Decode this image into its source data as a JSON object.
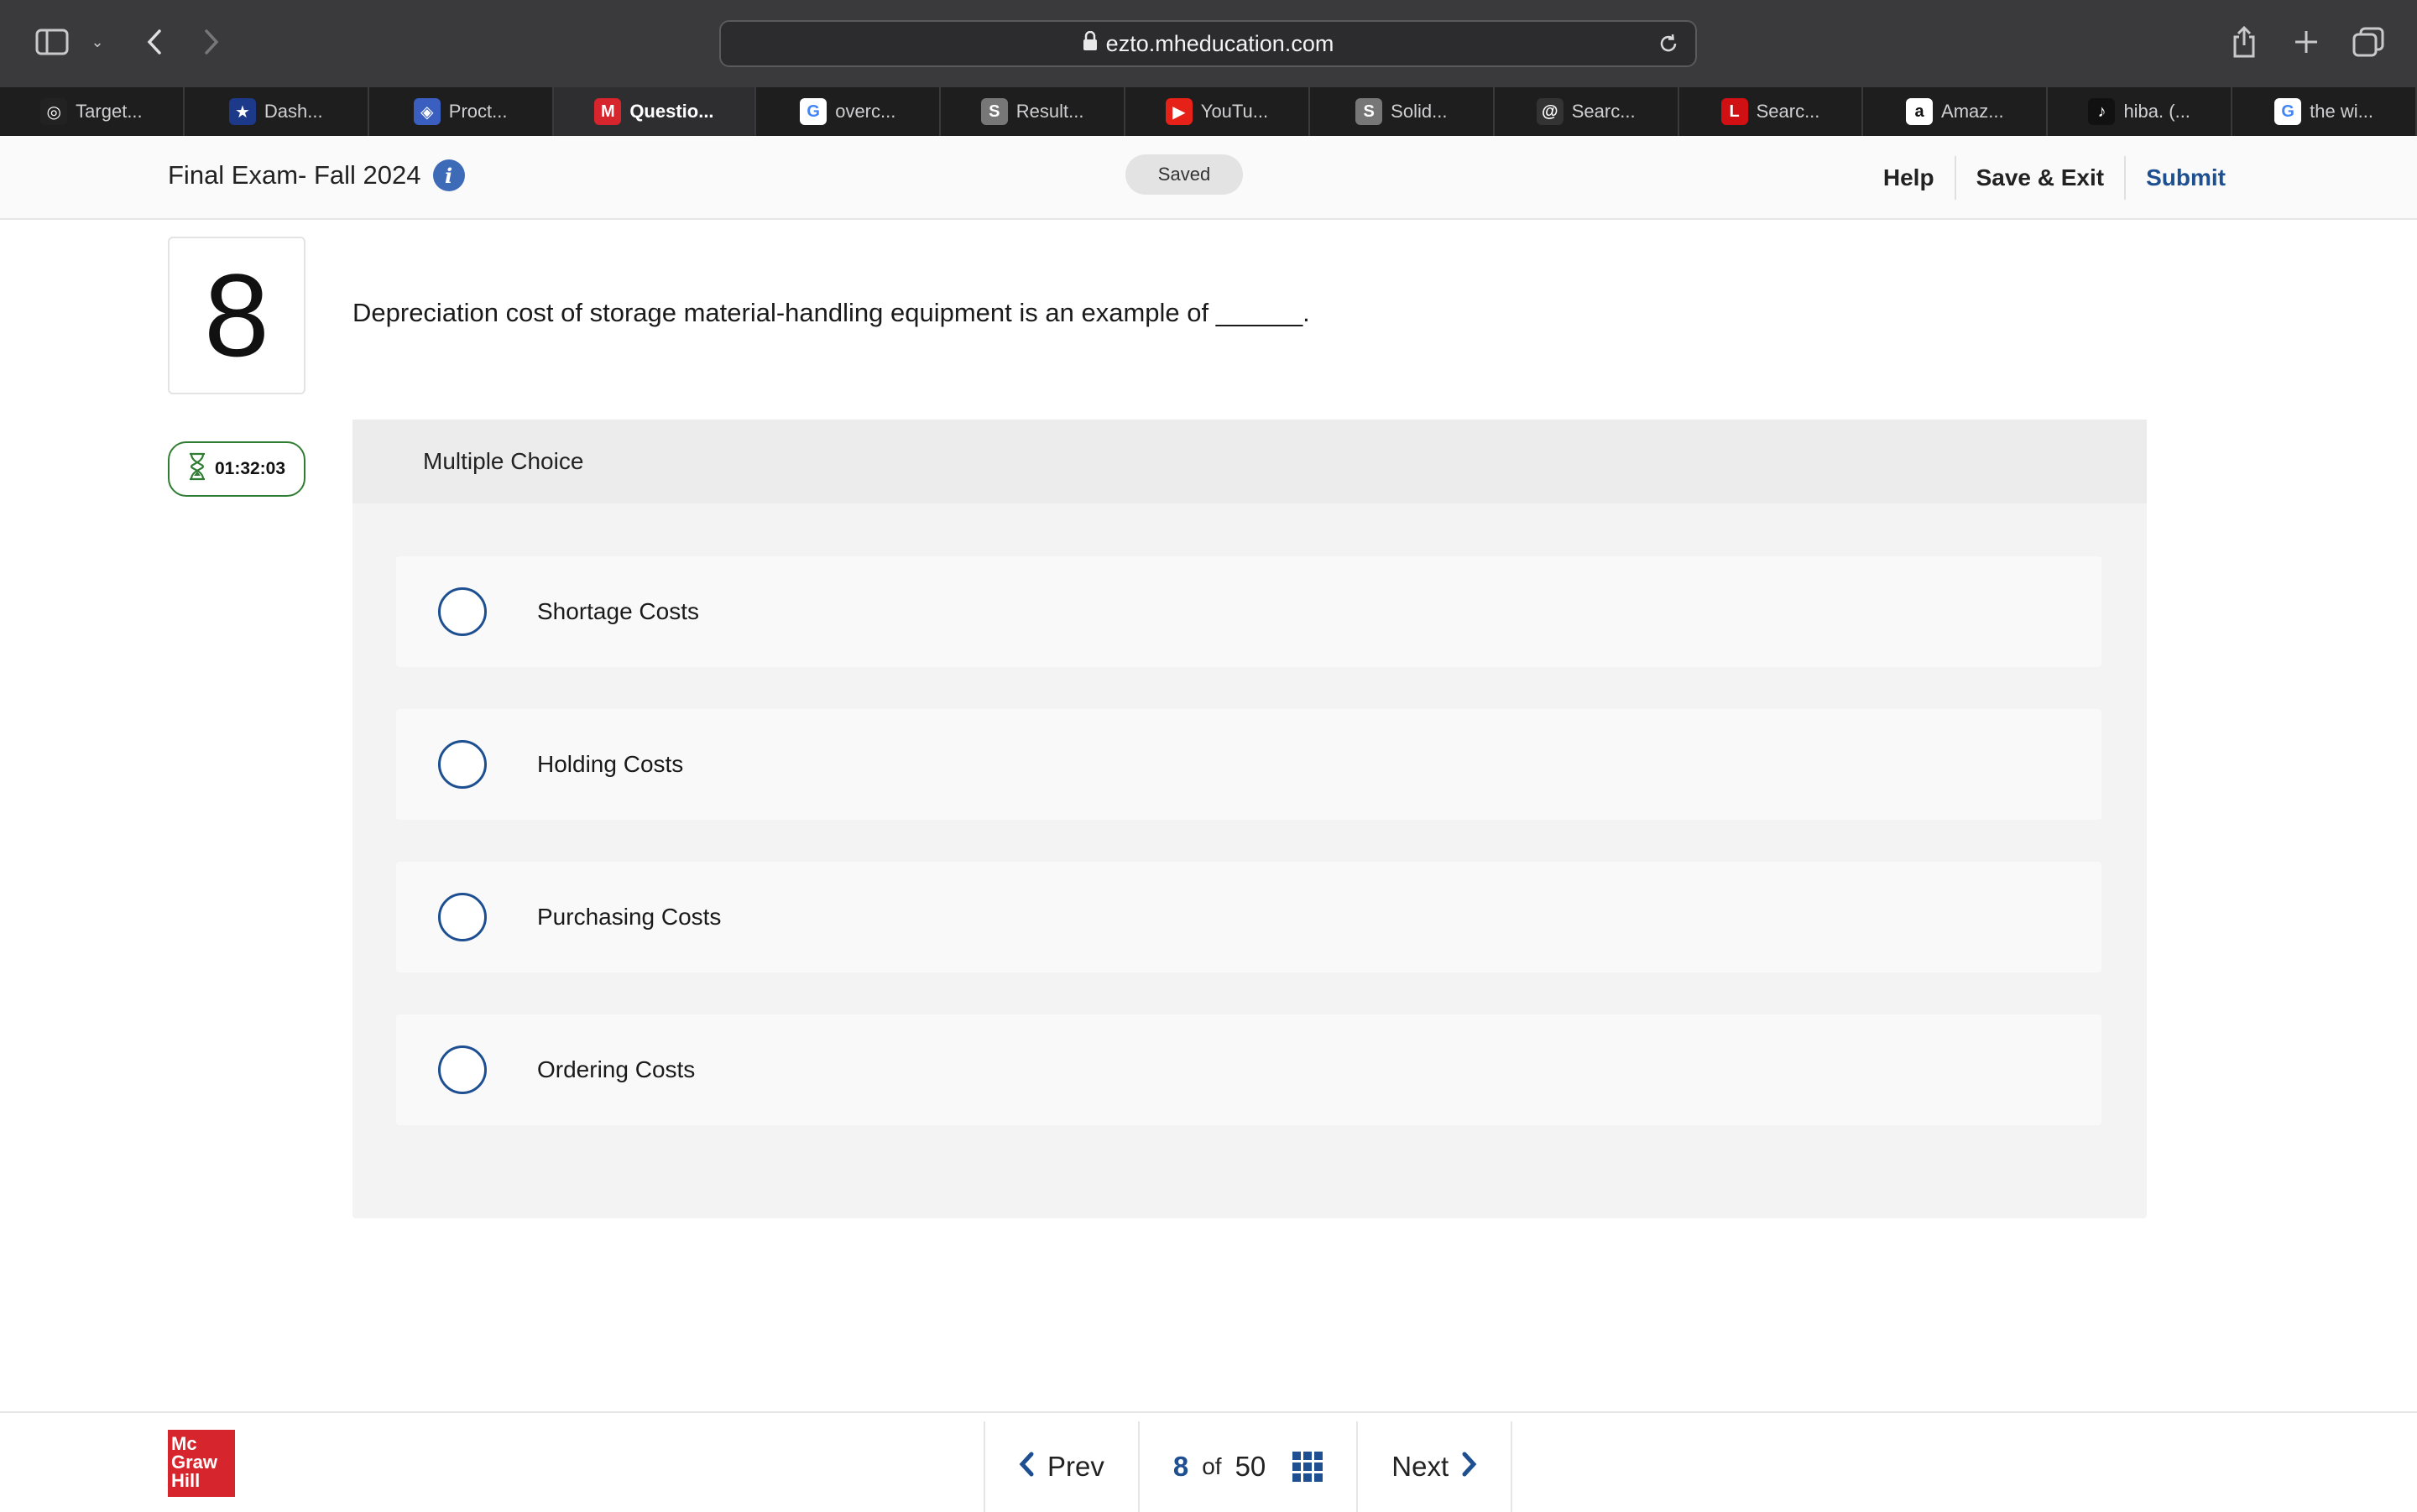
{
  "browser": {
    "url": "ezto.mheducation.com",
    "tabs": [
      {
        "label": "Target...",
        "icon": "openai-icon",
        "color": "#222222"
      },
      {
        "label": "Dash...",
        "icon": "star-badge-icon",
        "color": "#1d3a8a"
      },
      {
        "label": "Proct...",
        "icon": "shield-icon",
        "color": "#3b5fc0"
      },
      {
        "label": "Questio...",
        "icon": "mcgraw-m-icon",
        "color": "#d6252c",
        "active": true
      },
      {
        "label": "overc...",
        "icon": "google-icon",
        "color": "#ffffff"
      },
      {
        "label": "Result...",
        "icon": "s-icon",
        "color": "#777777"
      },
      {
        "label": "YouTu...",
        "icon": "youtube-icon",
        "color": "#e62117"
      },
      {
        "label": "Solid...",
        "icon": "s-icon",
        "color": "#777777"
      },
      {
        "label": "Searc...",
        "icon": "at-icon",
        "color": "#333333"
      },
      {
        "label": "Searc...",
        "icon": "lego-icon",
        "color": "#d01012"
      },
      {
        "label": "Amaz...",
        "icon": "amazon-icon",
        "color": "#ffffff"
      },
      {
        "label": "hiba. (...",
        "icon": "tiktok-icon",
        "color": "#111111"
      },
      {
        "label": "the wi...",
        "icon": "google-icon",
        "color": "#ffffff"
      }
    ]
  },
  "header": {
    "exam_title": "Final Exam- Fall 2024",
    "status": "Saved",
    "help": "Help",
    "save_exit": "Save & Exit",
    "submit": "Submit"
  },
  "question": {
    "number": "8",
    "text": "Depreciation cost of storage material-handling equipment is an example of ______.",
    "timer": "01:32:03",
    "type_label": "Multiple Choice",
    "options": [
      "Shortage Costs",
      "Holding Costs",
      "Purchasing Costs",
      "Ordering Costs"
    ]
  },
  "footer": {
    "logo_lines": [
      "Mc",
      "Graw",
      "Hill"
    ],
    "prev": "Prev",
    "current_page": "8",
    "of_label": "of",
    "total_pages": "50",
    "next": "Next"
  },
  "colors": {
    "accent": "#1d4f91",
    "timer_border": "#2e7d32",
    "logo_red": "#d6252c"
  }
}
